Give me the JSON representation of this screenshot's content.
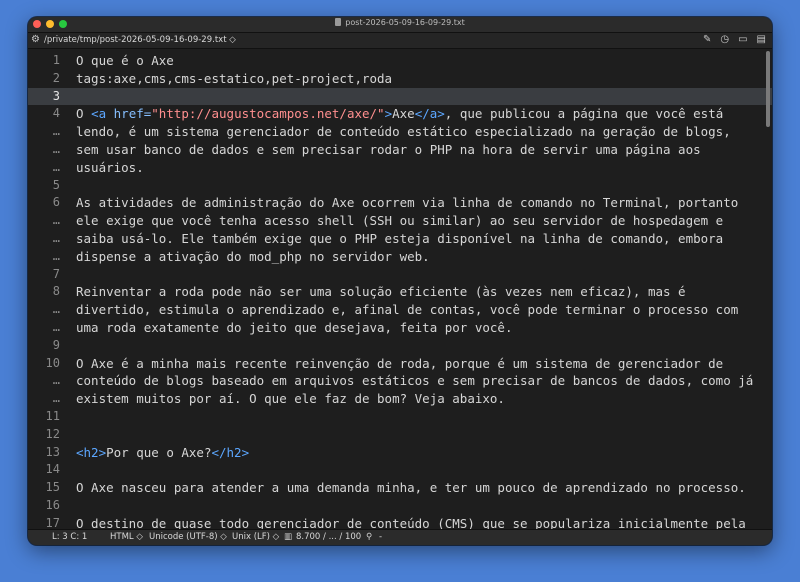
{
  "window": {
    "title": "post-2026-05-09-16-09-29.txt"
  },
  "pathbar": {
    "path": "/private/tmp/post-2026-05-09-16-09-29.txt ◇"
  },
  "editor": {
    "current_line": 3,
    "lines": [
      {
        "n": "1",
        "t": "O que é o Axe"
      },
      {
        "n": "2",
        "t": "tags:axe,cms,cms-estatico,pet-project,roda"
      },
      {
        "n": "3",
        "t": ""
      },
      {
        "n": "4",
        "t": "O <a href=\"http://augustocampos.net/axe/\">Axe</a>, que publicou a página que você está"
      },
      {
        "n": "…",
        "t": "lendo, é um sistema gerenciador de conteúdo estático especializado na geração de blogs,"
      },
      {
        "n": "…",
        "t": "sem usar banco de dados e sem precisar rodar o PHP na hora de servir uma página aos"
      },
      {
        "n": "…",
        "t": "usuários."
      },
      {
        "n": "5",
        "t": ""
      },
      {
        "n": "6",
        "t": "As atividades de administração do Axe ocorrem via linha de comando no Terminal, portanto"
      },
      {
        "n": "…",
        "t": "ele exige que você tenha acesso shell (SSH ou similar) ao seu servidor de hospedagem e"
      },
      {
        "n": "…",
        "t": "saiba usá-lo. Ele também exige que o PHP esteja disponível na linha de comando, embora"
      },
      {
        "n": "…",
        "t": "dispense a ativação do mod_php no servidor web."
      },
      {
        "n": "7",
        "t": ""
      },
      {
        "n": "8",
        "t": "Reinventar a roda pode não ser uma solução eficiente (às vezes nem eficaz), mas é"
      },
      {
        "n": "…",
        "t": "divertido, estimula o aprendizado e, afinal de contas, você pode terminar o processo com"
      },
      {
        "n": "…",
        "t": "uma roda exatamente do jeito que desejava, feita por você."
      },
      {
        "n": "9",
        "t": ""
      },
      {
        "n": "10",
        "t": "O Axe é a minha mais recente reinvenção de roda, porque é um sistema de gerenciador de"
      },
      {
        "n": "…",
        "t": "conteúdo de blogs baseado em arquivos estáticos e sem precisar de bancos de dados, como já"
      },
      {
        "n": "…",
        "t": "existem muitos por aí. O que ele faz de bom? Veja abaixo."
      },
      {
        "n": "11",
        "t": ""
      },
      {
        "n": "12",
        "t": ""
      },
      {
        "n": "13",
        "t": "<h2>Por que o Axe?</h2>"
      },
      {
        "n": "14",
        "t": ""
      },
      {
        "n": "15",
        "t": "O Axe nasceu para atender a uma demanda minha, e ter um pouco de aprendizado no processo."
      },
      {
        "n": "16",
        "t": ""
      },
      {
        "n": "17",
        "t": "O destino de quase todo gerenciador de conteúdo (CMS) que se populariza inicialmente pela"
      }
    ]
  },
  "statusbar": {
    "position": "L: 3 C: 1",
    "syntax": "HTML ◇",
    "encoding": "Unicode (UTF-8) ◇",
    "line_endings": "Unix (LF) ◇",
    "stats": "8.700 / ... / 100",
    "zoom": "-"
  }
}
